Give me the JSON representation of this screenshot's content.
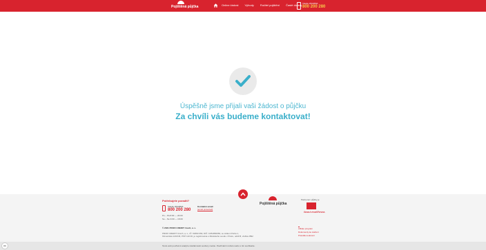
{
  "header": {
    "logo_text": "Pojištěná půjčka",
    "nav": [
      "Online žádost",
      "Výhody",
      "Ručitel pojištění",
      "Časté dotazy"
    ],
    "call_label": "Volejte ZDARMA",
    "call_number": "800 200 280"
  },
  "main": {
    "line1": "Úspěšně jsme přijali vaši žádost o půjčku",
    "line2": "Za chvíli vás budeme kontaktovat!"
  },
  "footer": {
    "help_title": "Potřebujete poradit?",
    "call_label": "Volejte ZDARMA",
    "call_number": "800 200 280",
    "hours1": "Po – Pá 8:00 — 20:00",
    "hours2": "So – Ne 9:00 — 16:00",
    "mail_label": "Kontaktní email:",
    "mail": "[email protected]",
    "logo_text": "Pojištěná půjčka",
    "partner_label": "Partnerem půjčky je",
    "partner_name": "ČESKÁ POJIŠŤOVNA",
    "copyright": "© 2021 PROFI CREDIT Czech, a. s.",
    "addr1": "PROFI CREDIT Czech, a. s., IČ: 61860 069, DIČ: CZ61860069, se sídlem Praha 1,",
    "addr2": "Klimentská 1216/46, PSČ 110 00, je registrována u Městského soudu v Praze, oddíl B, vložka 2892",
    "links": [
      "Afiliate program",
      "Dokumenty ke stažení",
      "Pravidla soukromí"
    ]
  },
  "cookie": {
    "text": "Tento web používá k analýze návštěvnosti soubory cookie. Používáním tohoto webu s tím souhlasíte.",
    "button": "OK"
  },
  "colors": {
    "brand": "#d8232e",
    "accent": "#3aafca"
  }
}
